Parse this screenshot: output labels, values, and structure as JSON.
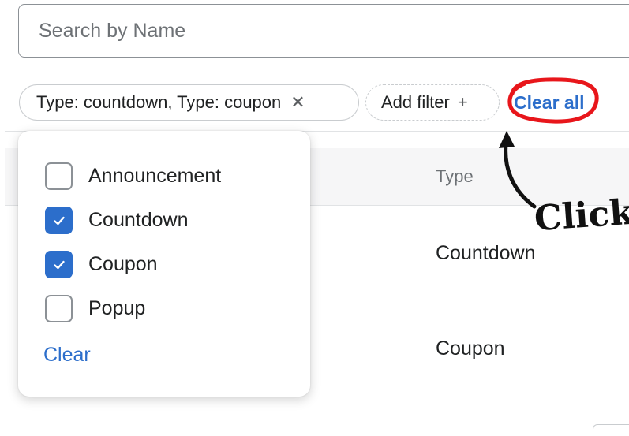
{
  "search": {
    "placeholder": "Search by Name"
  },
  "filters": {
    "applied_chip_label": "Type: countdown, Type: coupon",
    "add_filter_label": "Add filter",
    "clear_all_label": "Clear all"
  },
  "table": {
    "column_type_header": "Type",
    "rows": [
      {
        "type": "Countdown"
      },
      {
        "type": "Coupon"
      }
    ]
  },
  "type_popover": {
    "options": [
      {
        "label": "Announcement",
        "checked": false
      },
      {
        "label": "Countdown",
        "checked": true
      },
      {
        "label": "Coupon",
        "checked": true
      },
      {
        "label": "Popup",
        "checked": false
      }
    ],
    "clear_label": "Clear"
  },
  "annotation": {
    "text": "Click",
    "color": "#e8161b"
  },
  "colors": {
    "accent": "#2c6ecb",
    "annotation_red": "#e8161b"
  }
}
